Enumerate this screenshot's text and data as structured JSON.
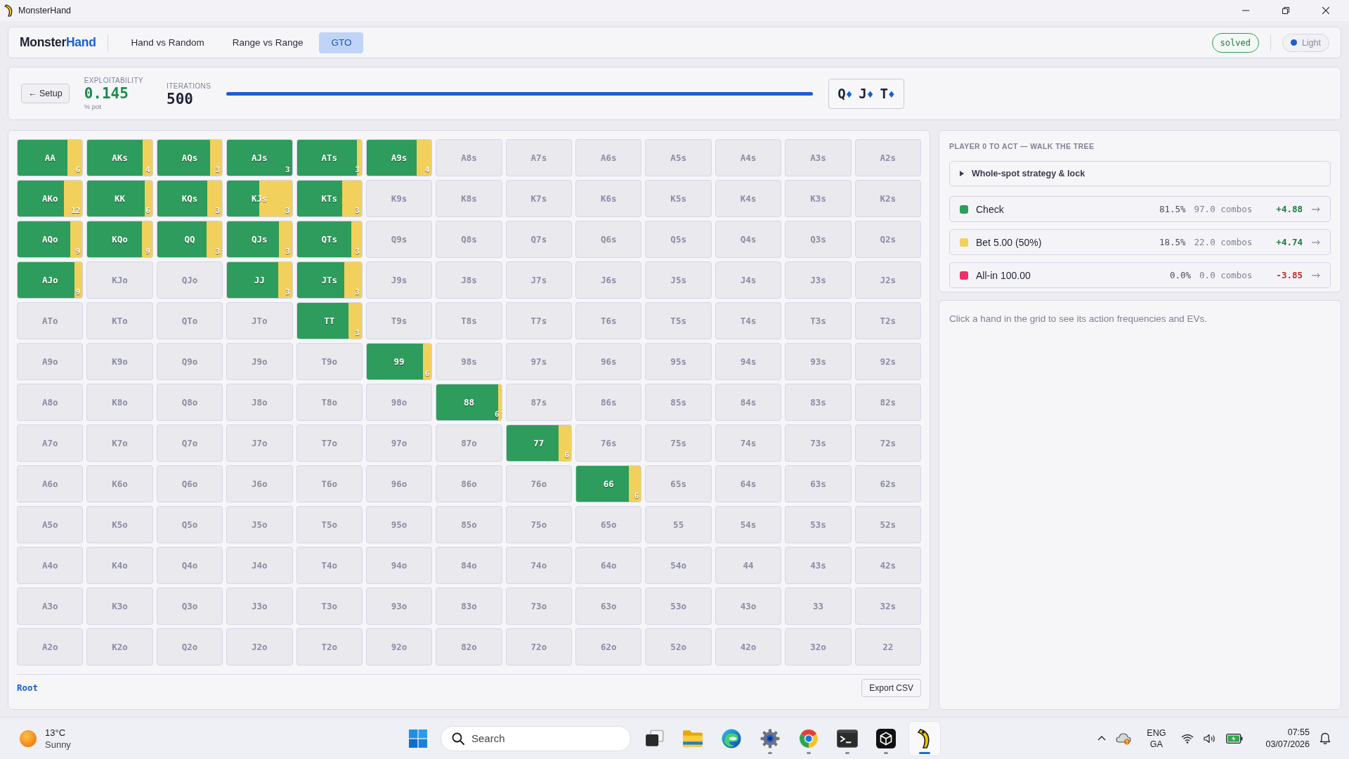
{
  "window": {
    "title": "MonsterHand"
  },
  "nav": {
    "logo": {
      "text": "Monster",
      "accent": "Hand"
    },
    "tabs": [
      {
        "label": "Hand vs Random",
        "selected": false
      },
      {
        "label": "Range vs Range",
        "selected": false
      },
      {
        "label": "GTO",
        "selected": true
      }
    ],
    "status": "solved",
    "theme": "Light"
  },
  "header": {
    "back_button": "← Setup",
    "exploitability": {
      "label": "EXPLOITABILITY",
      "value": "0.145",
      "unit": "% pot"
    },
    "iterations": {
      "label": "ITERATIONS",
      "value": "500"
    },
    "progress": {
      "level": 1
    },
    "board": [
      {
        "rank": "Q",
        "suit": "♦"
      },
      {
        "rank": "J",
        "suit": "♦"
      },
      {
        "rank": "T",
        "suit": "♦"
      }
    ]
  },
  "grid": {
    "rows": [
      {
        "cells": [
          {
            "label": "AA",
            "kind": "strategy",
            "level": 0.77,
            "combos": "6"
          },
          {
            "label": "AKs",
            "kind": "strategy",
            "level": 0.85,
            "combos": "4"
          },
          {
            "label": "AQs",
            "kind": "strategy",
            "level": 0.81,
            "combos": "3"
          },
          {
            "label": "AJs",
            "kind": "strategy",
            "level": 1,
            "combos": "3"
          },
          {
            "label": "ATs",
            "kind": "strategy",
            "level": 0.93,
            "combos": "3"
          },
          {
            "label": "A9s",
            "kind": "strategy",
            "level": 0.77,
            "combos": "4"
          },
          {
            "label": "A8s",
            "kind": "empty"
          },
          {
            "label": "A7s",
            "kind": "empty"
          },
          {
            "label": "A6s",
            "kind": "empty"
          },
          {
            "label": "A5s",
            "kind": "empty"
          },
          {
            "label": "A4s",
            "kind": "empty"
          },
          {
            "label": "A3s",
            "kind": "empty"
          },
          {
            "label": "A2s",
            "kind": "empty"
          }
        ]
      },
      {
        "cells": [
          {
            "label": "AKo",
            "kind": "strategy",
            "level": 0.71,
            "combos": "12"
          },
          {
            "label": "KK",
            "kind": "strategy",
            "level": 0.88,
            "combos": "6"
          },
          {
            "label": "KQs",
            "kind": "strategy",
            "level": 0.77,
            "combos": "3"
          },
          {
            "label": "KJs",
            "kind": "strategy",
            "level": 0.5,
            "combos": "3"
          },
          {
            "label": "KTs",
            "kind": "strategy",
            "level": 0.7,
            "combos": "3"
          },
          {
            "label": "K9s",
            "kind": "empty"
          },
          {
            "label": "K8s",
            "kind": "empty"
          },
          {
            "label": "K7s",
            "kind": "empty"
          },
          {
            "label": "K6s",
            "kind": "empty"
          },
          {
            "label": "K5s",
            "kind": "empty"
          },
          {
            "label": "K4s",
            "kind": "empty"
          },
          {
            "label": "K3s",
            "kind": "empty"
          },
          {
            "label": "K2s",
            "kind": "empty"
          }
        ]
      },
      {
        "cells": [
          {
            "label": "AQo",
            "kind": "strategy",
            "level": 0.81,
            "combos": "9"
          },
          {
            "label": "KQo",
            "kind": "strategy",
            "level": 0.84,
            "combos": "9"
          },
          {
            "label": "QQ",
            "kind": "strategy",
            "level": 0.76,
            "combos": "3"
          },
          {
            "label": "QJs",
            "kind": "strategy",
            "level": 0.8,
            "combos": "3"
          },
          {
            "label": "QTs",
            "kind": "strategy",
            "level": 0.84,
            "combos": "3"
          },
          {
            "label": "Q9s",
            "kind": "empty"
          },
          {
            "label": "Q8s",
            "kind": "empty"
          },
          {
            "label": "Q7s",
            "kind": "empty"
          },
          {
            "label": "Q6s",
            "kind": "empty"
          },
          {
            "label": "Q5s",
            "kind": "empty"
          },
          {
            "label": "Q4s",
            "kind": "empty"
          },
          {
            "label": "Q3s",
            "kind": "empty"
          },
          {
            "label": "Q2s",
            "kind": "empty"
          }
        ]
      },
      {
        "cells": [
          {
            "label": "AJo",
            "kind": "strategy",
            "level": 0.88,
            "combos": "9"
          },
          {
            "label": "KJo",
            "kind": "empty"
          },
          {
            "label": "QJo",
            "kind": "empty"
          },
          {
            "label": "JJ",
            "kind": "strategy",
            "level": 0.79,
            "combos": "3"
          },
          {
            "label": "JTs",
            "kind": "strategy",
            "level": 0.73,
            "combos": "3"
          },
          {
            "label": "J9s",
            "kind": "empty"
          },
          {
            "label": "J8s",
            "kind": "empty"
          },
          {
            "label": "J7s",
            "kind": "empty"
          },
          {
            "label": "J6s",
            "kind": "empty"
          },
          {
            "label": "J5s",
            "kind": "empty"
          },
          {
            "label": "J4s",
            "kind": "empty"
          },
          {
            "label": "J3s",
            "kind": "empty"
          },
          {
            "label": "J2s",
            "kind": "empty"
          }
        ]
      },
      {
        "cells": [
          {
            "label": "ATo",
            "kind": "empty"
          },
          {
            "label": "KTo",
            "kind": "empty"
          },
          {
            "label": "QTo",
            "kind": "empty"
          },
          {
            "label": "JTo",
            "kind": "empty"
          },
          {
            "label": "TT",
            "kind": "strategy",
            "level": 0.79,
            "combos": "3"
          },
          {
            "label": "T9s",
            "kind": "empty"
          },
          {
            "label": "T8s",
            "kind": "empty"
          },
          {
            "label": "T7s",
            "kind": "empty"
          },
          {
            "label": "T6s",
            "kind": "empty"
          },
          {
            "label": "T5s",
            "kind": "empty"
          },
          {
            "label": "T4s",
            "kind": "empty"
          },
          {
            "label": "T3s",
            "kind": "empty"
          },
          {
            "label": "T2s",
            "kind": "empty"
          }
        ]
      },
      {
        "cells": [
          {
            "label": "A9o",
            "kind": "empty"
          },
          {
            "label": "K9o",
            "kind": "empty"
          },
          {
            "label": "Q9o",
            "kind": "empty"
          },
          {
            "label": "J9o",
            "kind": "empty"
          },
          {
            "label": "T9o",
            "kind": "empty"
          },
          {
            "label": "99",
            "kind": "strategy",
            "level": 0.87,
            "combos": "6"
          },
          {
            "label": "98s",
            "kind": "empty"
          },
          {
            "label": "97s",
            "kind": "empty"
          },
          {
            "label": "96s",
            "kind": "empty"
          },
          {
            "label": "95s",
            "kind": "empty"
          },
          {
            "label": "94s",
            "kind": "empty"
          },
          {
            "label": "93s",
            "kind": "empty"
          },
          {
            "label": "92s",
            "kind": "empty"
          }
        ]
      },
      {
        "cells": [
          {
            "label": "A8o",
            "kind": "empty"
          },
          {
            "label": "K8o",
            "kind": "empty"
          },
          {
            "label": "Q8o",
            "kind": "empty"
          },
          {
            "label": "J8o",
            "kind": "empty"
          },
          {
            "label": "T8o",
            "kind": "empty"
          },
          {
            "label": "98o",
            "kind": "empty"
          },
          {
            "label": "88",
            "kind": "strategy",
            "level": 0.95,
            "combos": "6"
          },
          {
            "label": "87s",
            "kind": "empty"
          },
          {
            "label": "86s",
            "kind": "empty"
          },
          {
            "label": "85s",
            "kind": "empty"
          },
          {
            "label": "84s",
            "kind": "empty"
          },
          {
            "label": "83s",
            "kind": "empty"
          },
          {
            "label": "82s",
            "kind": "empty"
          }
        ]
      },
      {
        "cells": [
          {
            "label": "A7o",
            "kind": "empty"
          },
          {
            "label": "K7o",
            "kind": "empty"
          },
          {
            "label": "Q7o",
            "kind": "empty"
          },
          {
            "label": "J7o",
            "kind": "empty"
          },
          {
            "label": "T7o",
            "kind": "empty"
          },
          {
            "label": "97o",
            "kind": "empty"
          },
          {
            "label": "87o",
            "kind": "empty"
          },
          {
            "label": "77",
            "kind": "strategy",
            "level": 0.8,
            "combos": "6"
          },
          {
            "label": "76s",
            "kind": "empty"
          },
          {
            "label": "75s",
            "kind": "empty"
          },
          {
            "label": "74s",
            "kind": "empty"
          },
          {
            "label": "73s",
            "kind": "empty"
          },
          {
            "label": "72s",
            "kind": "empty"
          }
        ]
      },
      {
        "cells": [
          {
            "label": "A6o",
            "kind": "empty"
          },
          {
            "label": "K6o",
            "kind": "empty"
          },
          {
            "label": "Q6o",
            "kind": "empty"
          },
          {
            "label": "J6o",
            "kind": "empty"
          },
          {
            "label": "T6o",
            "kind": "empty"
          },
          {
            "label": "96o",
            "kind": "empty"
          },
          {
            "label": "86o",
            "kind": "empty"
          },
          {
            "label": "76o",
            "kind": "empty"
          },
          {
            "label": "66",
            "kind": "strategy",
            "level": 0.81,
            "combos": "6"
          },
          {
            "label": "65s",
            "kind": "empty"
          },
          {
            "label": "64s",
            "kind": "empty"
          },
          {
            "label": "63s",
            "kind": "empty"
          },
          {
            "label": "62s",
            "kind": "empty"
          }
        ]
      },
      {
        "cells": [
          {
            "label": "A5o",
            "kind": "empty"
          },
          {
            "label": "K5o",
            "kind": "empty"
          },
          {
            "label": "Q5o",
            "kind": "empty"
          },
          {
            "label": "J5o",
            "kind": "empty"
          },
          {
            "label": "T5o",
            "kind": "empty"
          },
          {
            "label": "95o",
            "kind": "empty"
          },
          {
            "label": "85o",
            "kind": "empty"
          },
          {
            "label": "75o",
            "kind": "empty"
          },
          {
            "label": "65o",
            "kind": "empty"
          },
          {
            "label": "55",
            "kind": "empty"
          },
          {
            "label": "54s",
            "kind": "empty"
          },
          {
            "label": "53s",
            "kind": "empty"
          },
          {
            "label": "52s",
            "kind": "empty"
          }
        ]
      },
      {
        "cells": [
          {
            "label": "A4o",
            "kind": "empty"
          },
          {
            "label": "K4o",
            "kind": "empty"
          },
          {
            "label": "Q4o",
            "kind": "empty"
          },
          {
            "label": "J4o",
            "kind": "empty"
          },
          {
            "label": "T4o",
            "kind": "empty"
          },
          {
            "label": "94o",
            "kind": "empty"
          },
          {
            "label": "84o",
            "kind": "empty"
          },
          {
            "label": "74o",
            "kind": "empty"
          },
          {
            "label": "64o",
            "kind": "empty"
          },
          {
            "label": "54o",
            "kind": "empty"
          },
          {
            "label": "44",
            "kind": "empty"
          },
          {
            "label": "43s",
            "kind": "empty"
          },
          {
            "label": "42s",
            "kind": "empty"
          }
        ]
      },
      {
        "cells": [
          {
            "label": "A3o",
            "kind": "empty"
          },
          {
            "label": "K3o",
            "kind": "empty"
          },
          {
            "label": "Q3o",
            "kind": "empty"
          },
          {
            "label": "J3o",
            "kind": "empty"
          },
          {
            "label": "T3o",
            "kind": "empty"
          },
          {
            "label": "93o",
            "kind": "empty"
          },
          {
            "label": "83o",
            "kind": "empty"
          },
          {
            "label": "73o",
            "kind": "empty"
          },
          {
            "label": "63o",
            "kind": "empty"
          },
          {
            "label": "53o",
            "kind": "empty"
          },
          {
            "label": "43o",
            "kind": "empty"
          },
          {
            "label": "33",
            "kind": "empty"
          },
          {
            "label": "32s",
            "kind": "empty"
          }
        ]
      },
      {
        "cells": [
          {
            "label": "A2o",
            "kind": "empty"
          },
          {
            "label": "K2o",
            "kind": "empty"
          },
          {
            "label": "Q2o",
            "kind": "empty"
          },
          {
            "label": "J2o",
            "kind": "empty"
          },
          {
            "label": "T2o",
            "kind": "empty"
          },
          {
            "label": "92o",
            "kind": "empty"
          },
          {
            "label": "82o",
            "kind": "empty"
          },
          {
            "label": "72o",
            "kind": "empty"
          },
          {
            "label": "62o",
            "kind": "empty"
          },
          {
            "label": "52o",
            "kind": "empty"
          },
          {
            "label": "42o",
            "kind": "empty"
          },
          {
            "label": "32o",
            "kind": "empty"
          },
          {
            "label": "22",
            "kind": "empty"
          }
        ]
      }
    ],
    "path": "Root",
    "export_button": "Export CSV"
  },
  "strategy": {
    "title": "PLAYER 0 TO ACT — WALK THE TREE",
    "disclosure": {
      "label": "Whole-spot strategy & lock",
      "expanded": false
    },
    "actions": [
      {
        "label": "Check",
        "color": "#2e9c5c",
        "frequency": "81.5%",
        "combos": "97.0 combos",
        "ev": "+4.88",
        "positive": true
      },
      {
        "label": "Bet 5.00 (50%)",
        "color": "#f2d05c",
        "frequency": "18.5%",
        "combos": "22.0 combos",
        "ev": "+4.74",
        "positive": true
      },
      {
        "label": "All-in 100.00",
        "color": "#ef2f6b",
        "frequency": "0.0%",
        "combos": "0.0 combos",
        "ev": "-3.85",
        "positive": false
      }
    ]
  },
  "detail": {
    "hint": "Click a hand in the grid to see its action frequencies and EVs."
  },
  "taskbar": {
    "weather": {
      "temperature": "13°C",
      "condition": "Sunny"
    },
    "search": {
      "placeholder": "Search"
    },
    "apps": [
      {
        "kind": "taskview",
        "running": false,
        "selected": false
      },
      {
        "kind": "folder",
        "running": false,
        "selected": false
      },
      {
        "kind": "swirl",
        "running": false,
        "selected": false
      },
      {
        "kind": "gear",
        "running": true,
        "selected": false
      },
      {
        "kind": "ring",
        "running": true,
        "selected": false
      },
      {
        "kind": "terminal",
        "running": true,
        "selected": false
      },
      {
        "kind": "cube",
        "running": true,
        "selected": false
      },
      {
        "kind": "app",
        "running": true,
        "selected": true
      }
    ],
    "language": {
      "code": "ENG",
      "layout": "GA"
    },
    "clock": {
      "time": "07:55",
      "date": "03/07/2026"
    }
  }
}
